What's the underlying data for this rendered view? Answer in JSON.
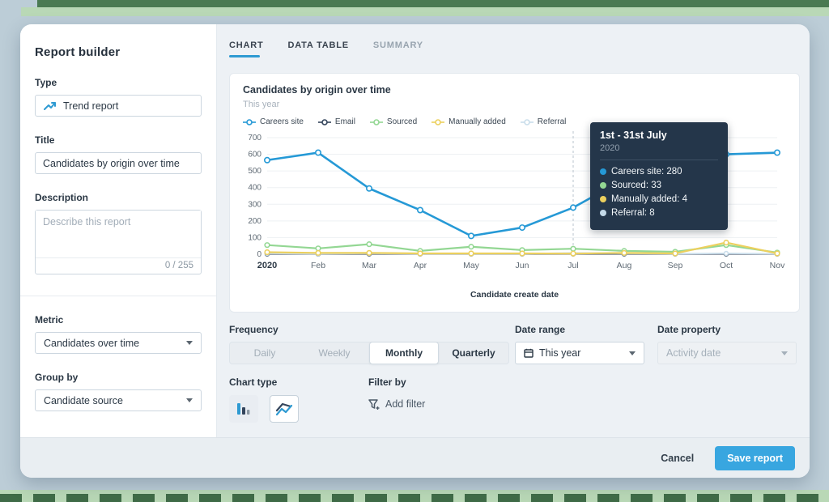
{
  "sidebar": {
    "title": "Report builder",
    "type_label": "Type",
    "type_value": "Trend report",
    "title_label": "Title",
    "title_value": "Candidates by origin over time",
    "description_label": "Description",
    "description_placeholder": "Describe this report",
    "description_counter": "0 / 255",
    "metric_label": "Metric",
    "metric_value": "Candidates over time",
    "group_by_label": "Group by",
    "group_by_value": "Candidate source"
  },
  "tabs": [
    {
      "label": "CHART"
    },
    {
      "label": "DATA TABLE"
    },
    {
      "label": "SUMMARY"
    }
  ],
  "chart_data": {
    "type": "line",
    "title": "Candidates by origin over time",
    "subtitle": "This year",
    "xlabel": "Candidate create date",
    "ylim": [
      0,
      700
    ],
    "ytick_step": 100,
    "grid": true,
    "legend_position": "top",
    "highlight_index": 6,
    "categories": [
      "2020",
      "Feb",
      "Mar",
      "Apr",
      "May",
      "Jun",
      "Jul",
      "Aug",
      "Sep",
      "Oct",
      "Nov"
    ],
    "series": [
      {
        "name": "Careers site",
        "color": "#2599d6",
        "z": 5,
        "width": 2.6,
        "r": 3.2,
        "values": [
          565,
          610,
          395,
          265,
          110,
          160,
          280,
          450,
          595,
          600,
          610
        ]
      },
      {
        "name": "Email",
        "color": "#34455c",
        "z": 1,
        "width": 1.8,
        "r": 2.4,
        "values": [
          2,
          2,
          2,
          2,
          2,
          2,
          2,
          2,
          2,
          2,
          2
        ]
      },
      {
        "name": "Sourced",
        "color": "#93d793",
        "z": 3,
        "width": 2.2,
        "r": 2.8,
        "values": [
          55,
          35,
          60,
          20,
          45,
          25,
          33,
          20,
          15,
          55,
          10
        ]
      },
      {
        "name": "Manually added",
        "color": "#ecd05e",
        "z": 4,
        "width": 2.2,
        "r": 2.8,
        "values": [
          12,
          8,
          8,
          5,
          5,
          5,
          4,
          8,
          5,
          70,
          5
        ]
      },
      {
        "name": "Referral",
        "color": "#cadeeb",
        "z": 2,
        "width": 1.8,
        "r": 2.4,
        "values": [
          5,
          3,
          5,
          3,
          3,
          3,
          8,
          5,
          3,
          5,
          3
        ]
      }
    ]
  },
  "tooltip": {
    "title": "1st - 31st July",
    "subtitle": "2020",
    "rows": [
      {
        "label": "Careers site",
        "value": 280,
        "color": "#2599d6"
      },
      {
        "label": "Sourced",
        "value": 33,
        "color": "#93d793"
      },
      {
        "label": "Manually added",
        "value": 4,
        "color": "#ecd05e"
      },
      {
        "label": "Referral",
        "value": 8,
        "color": "#c3d9e8"
      }
    ]
  },
  "controls": {
    "frequency_label": "Frequency",
    "frequency_options": [
      "Daily",
      "Weekly",
      "Monthly",
      "Quarterly"
    ],
    "frequency_selected": "Monthly",
    "date_range_label": "Date range",
    "date_range_value": "This year",
    "date_property_label": "Date property",
    "date_property_value": "Activity date",
    "chart_type_label": "Chart type",
    "filter_by_label": "Filter by",
    "add_filter_label": "Add filter"
  },
  "footer": {
    "cancel_label": "Cancel",
    "save_label": "Save report"
  },
  "colors": {
    "accent_blue": "#2e9ad2",
    "save_button": "#38a6e0",
    "tooltip_bg": "#24364a",
    "frame_dark_green": "#4a7a52",
    "frame_light_green": "#b9d8b6",
    "frame_blue_gray": "#bccdd7"
  }
}
